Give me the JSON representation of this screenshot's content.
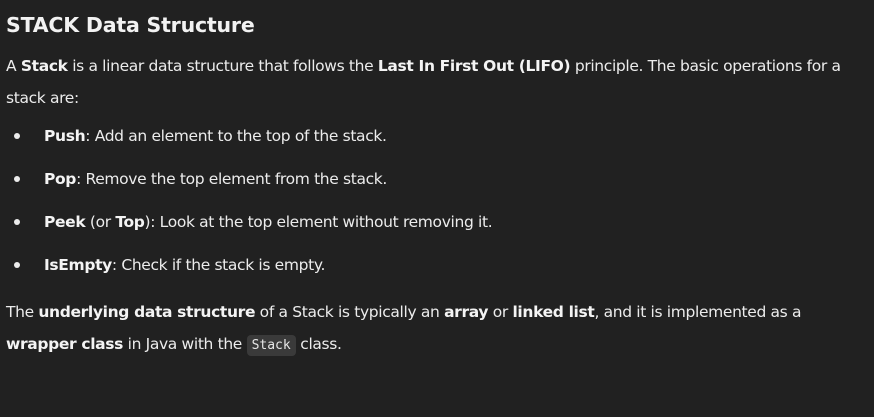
{
  "title": "STACK Data Structure",
  "intro": {
    "t1": "A ",
    "b1": "Stack",
    "t2": " is a linear data structure that follows the ",
    "b2": "Last In First Out (LIFO)",
    "t3": " principle. The basic operations for a stack are:"
  },
  "operations": [
    {
      "name": "Push",
      "text": ": Add an element to the top of the stack."
    },
    {
      "name": "Pop",
      "text": ": Remove the top element from the stack."
    },
    {
      "name": "Peek",
      "mid": " (or ",
      "alt": "Top",
      "text": "): Look at the top element without removing it."
    },
    {
      "name": "IsEmpty",
      "text": ": Check if the stack is empty."
    }
  ],
  "outro": {
    "t1": "The ",
    "b1": "underlying data structure",
    "t2": " of a Stack is typically an ",
    "b2": "array",
    "t3": " or ",
    "b3": "linked list",
    "t4": ", and it is implemented as a ",
    "b4": "wrapper class",
    "t5": " in Java with the ",
    "code": "Stack",
    "t6": " class."
  }
}
